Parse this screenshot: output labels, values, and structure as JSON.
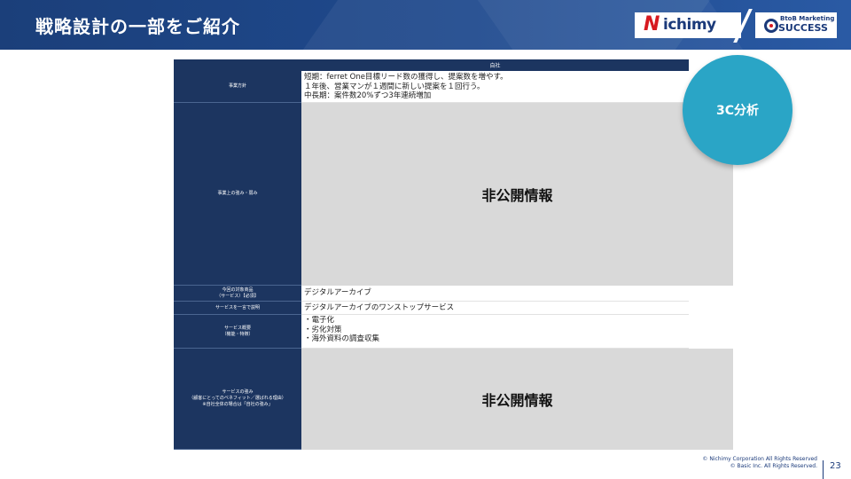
{
  "header": {
    "title": "戦略設計の一部をご紹介",
    "logo_nichimy": {
      "mark": "N",
      "text": "ichimy"
    },
    "logo_success": {
      "top": "BtoB Marketing",
      "main": "SUCCESS"
    }
  },
  "table": {
    "column_header": "自社",
    "rows": [
      {
        "label": "事業方針",
        "lines": [
          "短期：ferret One目標リード数の獲得し、提案数を増やす。",
          "１年後、営業マンが１週間に新しい提案を１回行う。",
          "中長期：案件数20%ずつ3年連続増加"
        ]
      },
      {
        "label": "事業上の強み・弱み",
        "redacted": "非公開情報"
      },
      {
        "label": "今回の対象商品\n（サービス）【必須】",
        "value": "デジタルアーカイブ"
      },
      {
        "label": "サービスを一言で説明",
        "value": "デジタルアーカイブのワンストップサービス"
      },
      {
        "label": "サービス概要\n（機能・特徴）",
        "lines": [
          "・電子化",
          "・劣化対策",
          "・海外資料の調査収集"
        ]
      },
      {
        "label": "サービスの強み\n（顧客にとってのベネフィット／選ばれる理由）\n※自社全体の場合は「自社の強み」",
        "redacted": "非公開情報"
      }
    ]
  },
  "badge": {
    "label": "3C分析"
  },
  "footer": {
    "copyright_1": "© Nichimy Corporation All Rights Reserved",
    "copyright_2": "© Basic Inc. All Rights Reserved.",
    "page_number": "23"
  },
  "colors": {
    "navy": "#1c3560",
    "accent": "#2aa5c6",
    "redacted_gray": "#d9d9d9"
  }
}
